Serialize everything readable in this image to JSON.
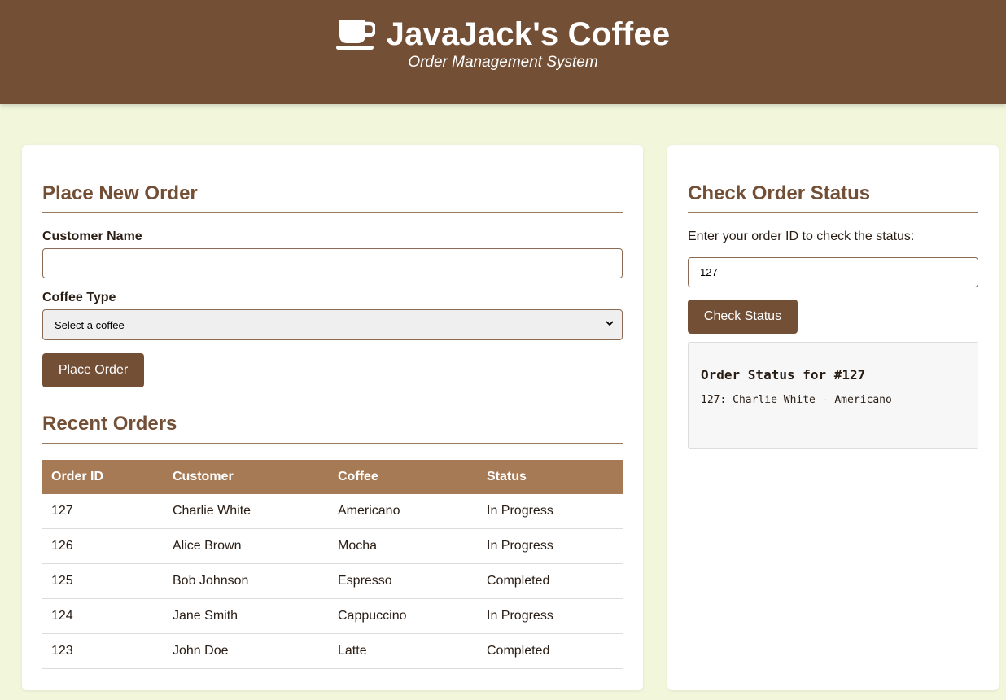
{
  "header": {
    "title": "JavaJack's Coffee",
    "subtitle": "Order Management System",
    "icon": "coffee-cup-icon"
  },
  "place_order": {
    "title": "Place New Order",
    "customer_label": "Customer Name",
    "customer_value": "",
    "coffee_label": "Coffee Type",
    "coffee_selected": "Select a coffee",
    "button_label": "Place Order"
  },
  "recent_orders": {
    "title": "Recent Orders",
    "columns": [
      "Order ID",
      "Customer",
      "Coffee",
      "Status"
    ],
    "rows": [
      [
        "127",
        "Charlie White",
        "Americano",
        "In Progress"
      ],
      [
        "126",
        "Alice Brown",
        "Mocha",
        "In Progress"
      ],
      [
        "125",
        "Bob Johnson",
        "Espresso",
        "Completed"
      ],
      [
        "124",
        "Jane Smith",
        "Cappuccino",
        "In Progress"
      ],
      [
        "123",
        "John Doe",
        "Latte",
        "Completed"
      ]
    ]
  },
  "check_status": {
    "title": "Check Order Status",
    "help_text": "Enter your order ID to check the status:",
    "order_id_value": "127",
    "button_label": "Check Status",
    "result_heading": "Order Status for #127",
    "result_line": "127: Charlie White - Americano"
  },
  "colors": {
    "brand": "#734f36",
    "table_header": "#a77a56",
    "page_bg": "#f2f7dc"
  }
}
